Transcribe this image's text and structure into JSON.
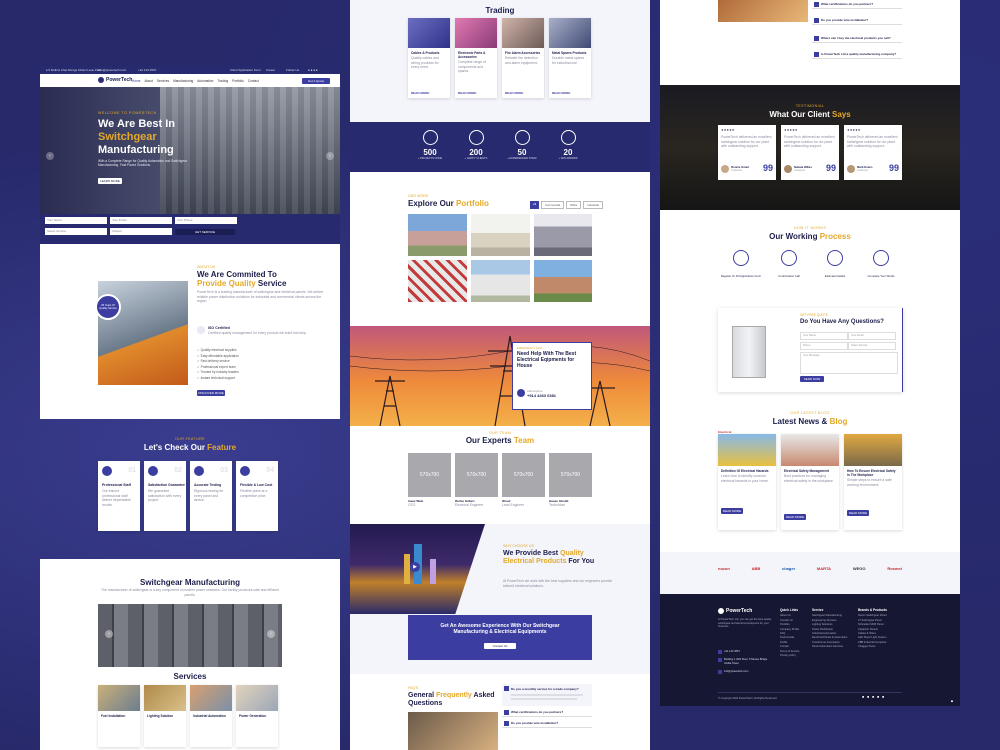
{
  "topbar": {
    "address": "1/1 Rollins Chel Ahrogs Kirtani Lane Park",
    "email": "info@powertech.com",
    "phone": "+91 123 4567",
    "right": [
      "Client Application Form",
      "Career",
      "Follow Us"
    ]
  },
  "nav": {
    "logo": "PowerTech",
    "items": [
      "Home",
      "About",
      "Services",
      "Manufacturing",
      "Automation",
      "Trading",
      "Portfolio",
      "Contact"
    ],
    "cta": "Get A Quote"
  },
  "hero": {
    "kicker": "WELCOME TO POWERTECH",
    "line1": "We Are Best In",
    "line2": "Switchgear",
    "line3": "Manufacturing",
    "desc": "With a Complete Range for Quality Automation and Switchgear Manufacturing. Fast Paced Solutions.",
    "button": "LEARN MORE"
  },
  "form": {
    "f1": "Your Name",
    "f2": "Your Email",
    "f3": "Your Phone",
    "f4": "Select Service",
    "f5": "Subject",
    "submit": "GET SERVICE"
  },
  "about": {
    "kicker": "ABOUT US",
    "title1": "We Are Commited To",
    "title2": "Provide Quality",
    "title3": "Service",
    "badge": "25 Years Of Quality Service",
    "p": "PowerTech is a leading manufacturer of switchgear and electrical panels. We deliver reliable power distribution solutions for industrial and commercial clients across the region.",
    "iso": "ISO Certified",
    "iso_desc": "Certified quality management for every product we build and ship.",
    "checks": [
      "Quality electrical supplies",
      "Easy affordable application",
      "Fast delivery service",
      "Professional expert team",
      "Trusted by industry leaders",
      "Instant technical support"
    ],
    "button": "DISCOVER MORE"
  },
  "features": {
    "kicker": "OUR FEATURE",
    "title1": "Let's Check Our",
    "title2": "Feature",
    "items": [
      {
        "n": "01",
        "t": "Professional Staff",
        "d": "Our trained professional staff deliver dependable results."
      },
      {
        "n": "02",
        "t": "Satisfaction Guarantee",
        "d": "We guarantee satisfaction with every project."
      },
      {
        "n": "03",
        "t": "Accurate Testing",
        "d": "Rigorous testing for every panel and device."
      },
      {
        "n": "04",
        "t": "Flexible & Low Cost",
        "d": "Flexible plans at a competitive price."
      }
    ]
  },
  "switchgear": {
    "title": "Switchgear Manufacturing",
    "desc": "The manufacturer of switchgear is a key component of modern power networks. Our facility produces safe and efficient panels.",
    "services_title": "Services",
    "services": [
      "Fuel Installation",
      "Lighting Solution",
      "Industrial Automation",
      "Power Generation"
    ]
  },
  "trading": {
    "title": "Trading",
    "items": [
      {
        "t": "Cables & Products",
        "d": "Quality cables and wiring products for every need."
      },
      {
        "t": "Electronic Parts & Accessories",
        "d": "Complete range of components and spares."
      },
      {
        "t": "Fire Alarm Accessories",
        "d": "Reliable fire detection and alarm equipment."
      },
      {
        "t": "Metal Spares Products",
        "d": "Durable metal spares for industrial use."
      }
    ],
    "more": "READ MORE"
  },
  "stats": [
    {
      "v": "500",
      "l": "+ PROJECTS DONE"
    },
    {
      "v": "200",
      "l": "+ HAPPY CLIENTS"
    },
    {
      "v": "50",
      "l": "+ EXPERIENCED STAFF"
    },
    {
      "v": "20",
      "l": "+ WIN AWARDS"
    }
  ],
  "portfolio": {
    "kicker": "OUR WORK",
    "title1": "Explore Our",
    "title2": "Portfolio",
    "tabs": [
      "All",
      "Commercial",
      "Office",
      "Industrial"
    ]
  },
  "help": {
    "kicker": "EMERGENCY CALL",
    "title": "Need Help With The Best Electrical Eqipments for House",
    "call_label": "Call Anytime",
    "phone": "+914 4463 0381"
  },
  "team": {
    "kicker": "OUR TEAM",
    "title1": "Our Experts",
    "title2": "Team",
    "placeholder": "570x700",
    "members": [
      {
        "n": "Isaac Wale",
        "r": "CEO"
      },
      {
        "n": "Richie Gilbert",
        "r": "Electrical Engineer"
      },
      {
        "n": "Woud",
        "r": "Lead Engineer"
      },
      {
        "n": "Hasan Gboldi",
        "r": "Technician"
      }
    ]
  },
  "why": {
    "kicker": "WHY CHOOSE US",
    "title1": "We Provide Best",
    "title2": "Quality Electrical Products",
    "title3": "For You",
    "desc": "At PowerTech we work with the best suppliers and our engineers provide tailored electrical solutions."
  },
  "banner": {
    "title": "Get An Awesome Experience With Our Switchgear Manufacturing & Electrical Equipments",
    "button": "Contact Us"
  },
  "faq": {
    "kicker": "FAQ'S",
    "title1": "General",
    "title2": "Frequently",
    "title3": "Asked",
    "title4": "Questions",
    "items": [
      "Do you a monthly service for a trade company?",
      "What certifications do you partners?",
      "Do you provide wire installation?",
      "Where can I buy the electrical products you sell?",
      "Is PowerTech Ltd a quality manufacturing company?"
    ]
  },
  "testimonials": {
    "kicker": "TESTIMONIAL",
    "title1": "What Our Client",
    "title2": "Says",
    "items": [
      {
        "n": "Ronnie Smart",
        "r": "Customer",
        "s": "99"
      },
      {
        "n": "Nabaia Willes",
        "r": "Customer",
        "s": "99"
      },
      {
        "n": "Mark Evans",
        "r": "Customer",
        "s": "99"
      }
    ],
    "quote": "PowerTech delivered an excellent switchgear solution for our plant with outstanding support."
  },
  "process": {
    "kicker": "HOW IT WORKS",
    "title1": "Our Working",
    "title2": "Process",
    "steps": [
      "Register Or Fill Application Form",
      "Confirmation Call",
      "Estimate Details",
      "Complete Your Works"
    ]
  },
  "contact": {
    "kicker": "GET FREE QUOTE",
    "title": "Do You Have Any Questions?",
    "f1": "Your Name",
    "f2": "Your Email",
    "f3": "Phone",
    "f4": "Select Service",
    "f5": "Your Message",
    "submit": "SEND NOW"
  },
  "blog": {
    "kicker": "OUR LATEST BLOG",
    "title1": "Latest News &",
    "title2": "Blog",
    "tag": "Electrical",
    "items": [
      {
        "t": "Definition Of Electrical Hazards",
        "d": "Learn how to identify common electrical hazards in your home."
      },
      {
        "t": "Electrical Safety Management",
        "d": "Best practices for managing electrical safety in the workplace."
      },
      {
        "t": "How To Ensure Electrical Safety In The Workplace",
        "d": "Simple steps to ensure a safe working environment."
      }
    ],
    "more": "READ MORE"
  },
  "brands": [
    "nozon",
    "ABB",
    "chager",
    "MARTA",
    "WEGO",
    "Rosmet"
  ],
  "footer": {
    "logo": "PowerTech",
    "desc": "At PowerTech Ltd, you can get the best-quality switchgear and electrical equipment for your business.",
    "phone": "+91 123 4567",
    "address": "Building 1 29th Floor, 5 Mouse Bridge Vedita Tower",
    "email": "info@powertech.com",
    "cols": [
      {
        "h": "Quick Links",
        "items": [
          "About Us",
          "Contact Us",
          "Portfolio",
          "Company Profile",
          "FAQ",
          "Testimonials",
          "Profile",
          "Contact",
          "Terms of Service",
          "Privacy policy"
        ]
      },
      {
        "h": "Service",
        "items": [
          "Switchgear Manufacturing",
          "Engineering Services",
          "Lighting Solutions",
          "Power Distribution",
          "Industrial Automation",
          "Electrical Panels & Automation",
          "Transformer Automation",
          "Panel Automation Services"
        ]
      },
      {
        "h": "Brands & Products",
        "items": [
          "Nozon Switchgear Panel",
          "LT Switchgear Panel",
          "Schneider MCB Panel",
          "Capacitor Panels",
          "Cables & Wires",
          "LED Street Light System",
          "ABB Industrial Complete",
          "Chagger Panel"
        ]
      }
    ],
    "copy": "© Copyright 2024 PowerTech | All Rights Reserved"
  }
}
